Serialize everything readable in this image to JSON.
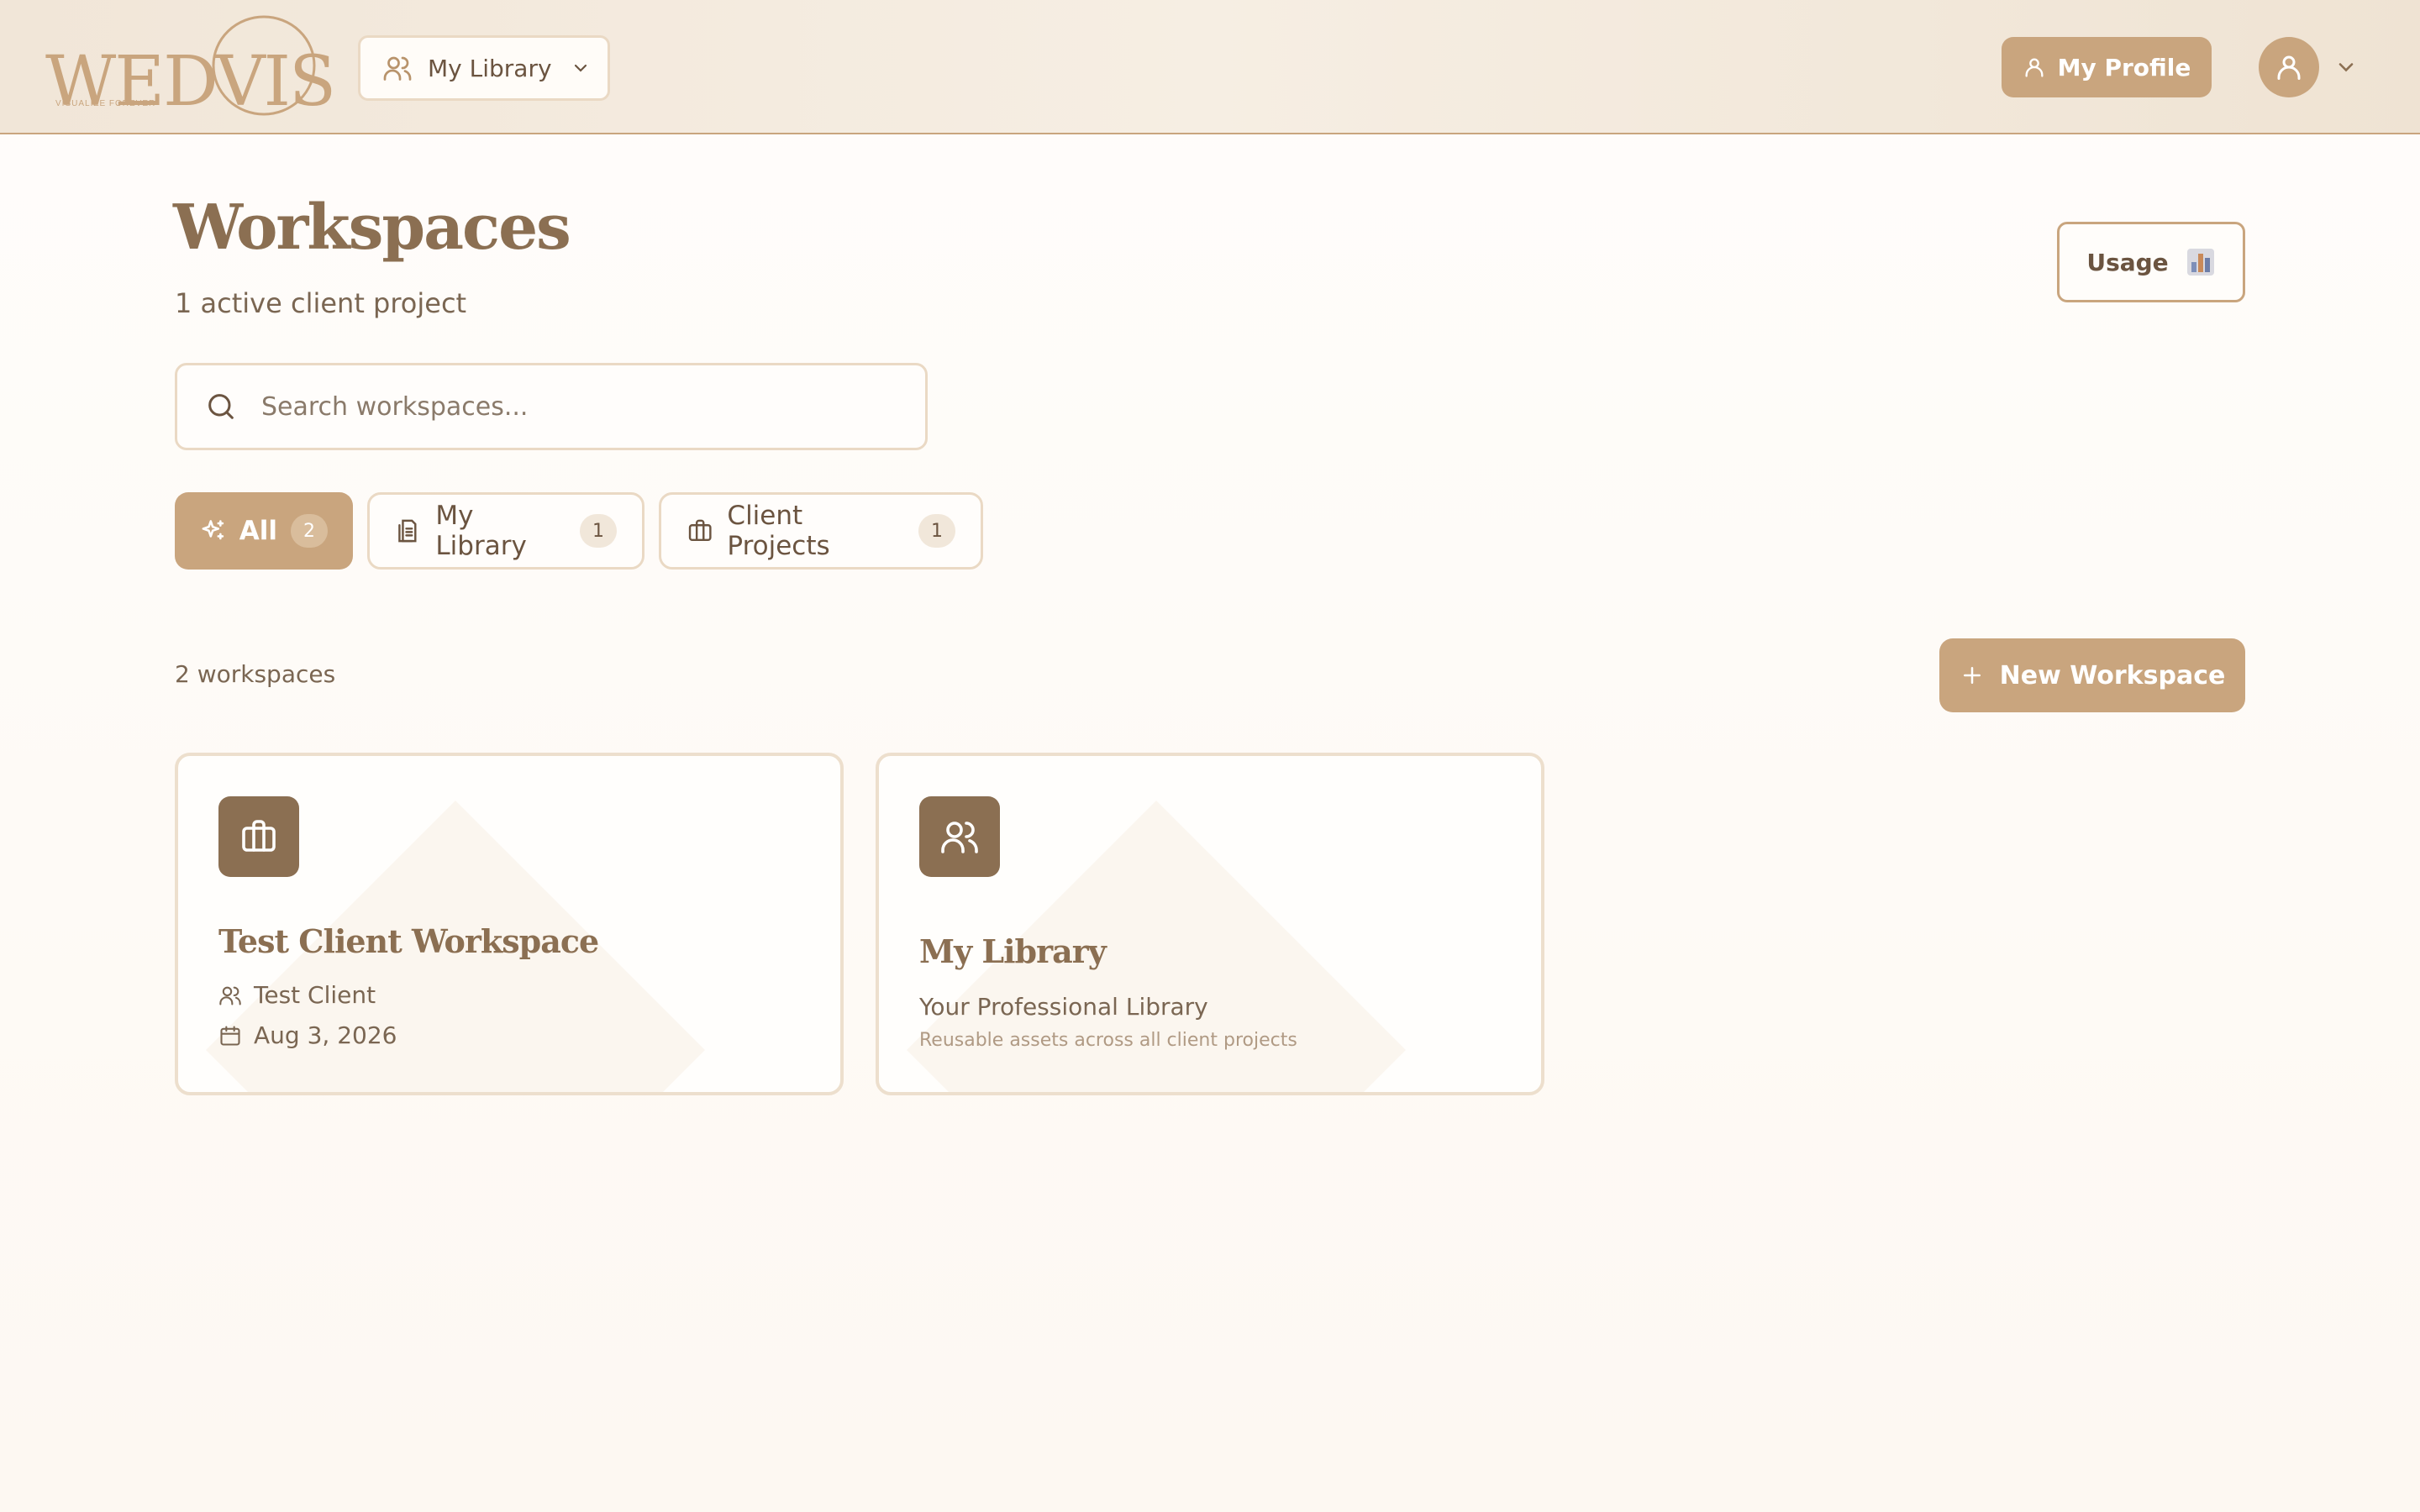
{
  "brand": {
    "logo_word": "WEDVIS",
    "logo_tagline": "VISUALIZE FOREVER",
    "accent": "#c9a57e",
    "dark_accent": "#8b6f52"
  },
  "header": {
    "library_select": {
      "label": "My Library",
      "icon": "users-icon"
    },
    "profile_button": {
      "label": "My Profile",
      "icon": "user-icon"
    },
    "avatar_icon": "user-icon"
  },
  "page": {
    "title": "Workspaces",
    "subtitle": "1 active client project",
    "usage_button": {
      "label": "Usage",
      "icon": "bar-chart-icon"
    }
  },
  "search": {
    "placeholder": "Search workspaces...",
    "value": ""
  },
  "tabs": [
    {
      "label": "All",
      "count": "2",
      "icon": "sparkles-icon",
      "active": true
    },
    {
      "label": "My Library",
      "count": "1",
      "icon": "library-icon",
      "active": false
    },
    {
      "label": "Client Projects",
      "count": "1",
      "icon": "briefcase-icon",
      "active": false
    }
  ],
  "list": {
    "count_label": "2 workspaces",
    "new_button": {
      "label": "New Workspace",
      "icon": "plus-icon"
    }
  },
  "workspaces": [
    {
      "title": "Test Client Workspace",
      "icon": "briefcase-icon",
      "client": "Test Client",
      "date": "Aug 3, 2026"
    },
    {
      "title": "My Library",
      "icon": "users-icon",
      "subtitle": "Your Professional Library",
      "description": "Reusable assets across all client projects"
    }
  ]
}
